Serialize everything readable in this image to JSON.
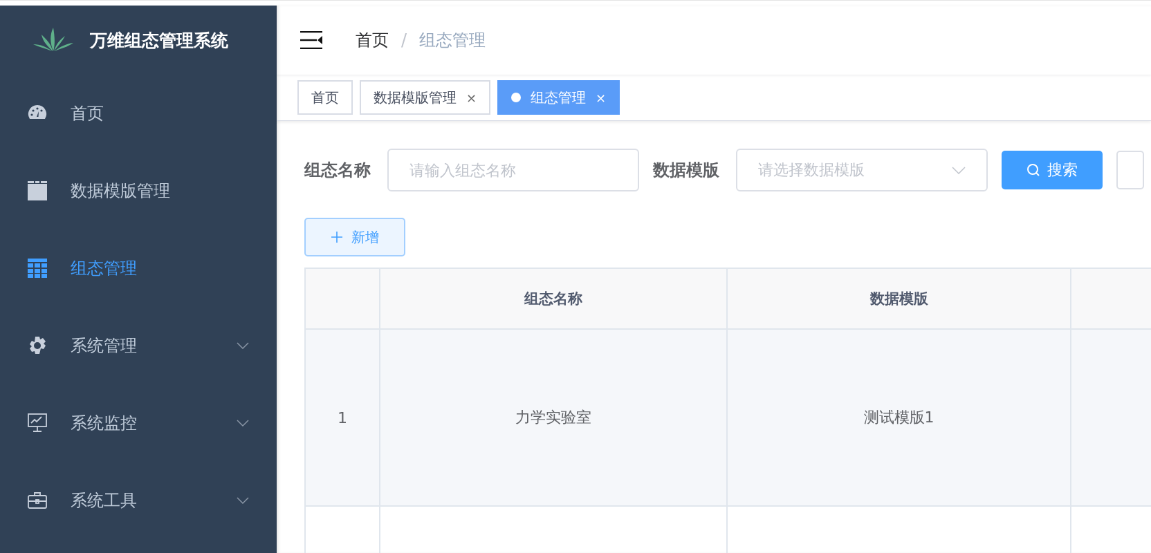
{
  "app_title": "万维组态管理系统",
  "sidebar": {
    "items": [
      {
        "label": "首页",
        "kind": "dashboard",
        "selected": false,
        "expandable": false
      },
      {
        "label": "数据模版管理",
        "kind": "folder",
        "selected": false,
        "expandable": false
      },
      {
        "label": "组态管理",
        "kind": "grid",
        "selected": true,
        "expandable": false
      },
      {
        "label": "系统管理",
        "kind": "gear",
        "selected": false,
        "expandable": true
      },
      {
        "label": "系统监控",
        "kind": "monitor",
        "selected": false,
        "expandable": true
      },
      {
        "label": "系统工具",
        "kind": "toolbox",
        "selected": false,
        "expandable": true
      }
    ]
  },
  "breadcrumb_separator": "/",
  "breadcrumb": [
    {
      "label": "首页",
      "current": false
    },
    {
      "label": "组态管理",
      "current": true
    }
  ],
  "tabs": [
    {
      "label": "首页",
      "selected": false,
      "closable": false
    },
    {
      "label": "数据模版管理",
      "selected": false,
      "closable": true
    },
    {
      "label": "组态管理",
      "selected": true,
      "closable": true
    }
  ],
  "close_glyph": "×",
  "filters": [
    {
      "label": "组态名称",
      "kind": "input",
      "placeholder": "请输入组态名称"
    },
    {
      "label": "数据模版",
      "kind": "select",
      "placeholder": "请选择数据模版"
    }
  ],
  "search_button": "搜索",
  "add_button": "新增",
  "table": {
    "columns": [
      "",
      "组态名称",
      "数据模版"
    ],
    "rows": [
      {
        "cells": [
          "1",
          "力学实验室",
          "测试模版1"
        ]
      }
    ]
  }
}
